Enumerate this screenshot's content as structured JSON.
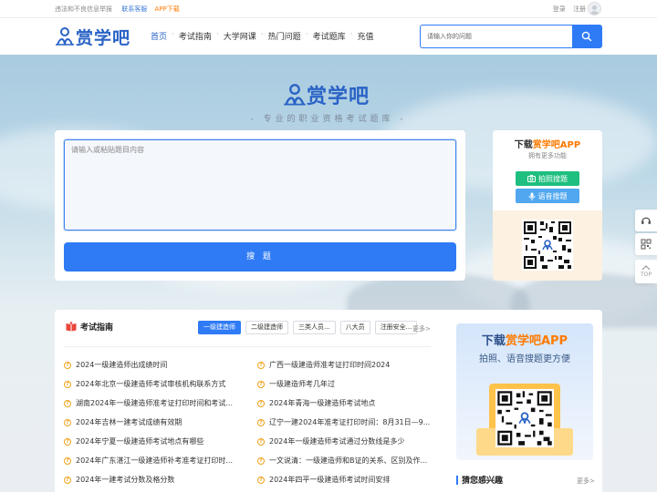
{
  "topbar": {
    "notice": "违法和不良信息举报",
    "contact": "联系客服",
    "app_download": "APP下载",
    "login": "登录",
    "register": "注册"
  },
  "brand": {
    "name": "赏学吧",
    "accent_color": "#2a63c6",
    "primary_button_color": "#2f7bf5"
  },
  "nav": {
    "items": [
      {
        "label": "首页",
        "active": true
      },
      {
        "label": "考试指南"
      },
      {
        "label": "大学网课"
      },
      {
        "label": "热门问题"
      },
      {
        "label": "考试题库"
      },
      {
        "label": "充值"
      }
    ],
    "search_placeholder": "请输入你的问题"
  },
  "hero": {
    "slogan": "- 专业的职业资格考试题库 -",
    "question_placeholder": "请输入或粘贴题目内容",
    "submit_label": "搜 题"
  },
  "app_card": {
    "title_prefix": "下载",
    "title_highlight": "赏学吧APP",
    "subtitle": "拥有更多功能",
    "photo_search": "拍照搜题",
    "voice_search": "语音搜题"
  },
  "side_tools": {
    "top_label": "TOP"
  },
  "guide": {
    "title": "考试指南",
    "tabs": [
      "一级建造师",
      "二级建造师",
      "三类人员...",
      "八大员",
      "注册安全..."
    ],
    "more": "更多>",
    "left_items": [
      "2024一级建造师出成绩时间",
      "2024年北京一级建造师考试审核机构联系方式",
      "湖南2024年一级建造师准考证打印时间和考试...",
      "2024年吉林一建考试成绩有效期",
      "2024年宁夏一级建造师考试地点有哪些",
      "2024年广东湛江一级建造师补考准考证打印时...",
      "2024年一建考试分数及格分数"
    ],
    "right_items": [
      "广西一级建造师准考证打印时间2024",
      "一级建造师考几年过",
      "2024年青海一级建造师考试地点",
      "辽宁一建2024年准考证打印时间：8月31日—9...",
      "2024年一级建造师考试通过分数线是多少",
      "一文说清：一级建造师和B证的关系、区别及作...",
      "2024年四平一级建造师考试时间安排"
    ]
  },
  "promo": {
    "line1_prefix": "下载",
    "line1_highlight": "赏学吧APP",
    "line2": "拍照、语音搜题更方便"
  },
  "guess": {
    "title": "猜您感兴趣",
    "more": "更多>"
  }
}
